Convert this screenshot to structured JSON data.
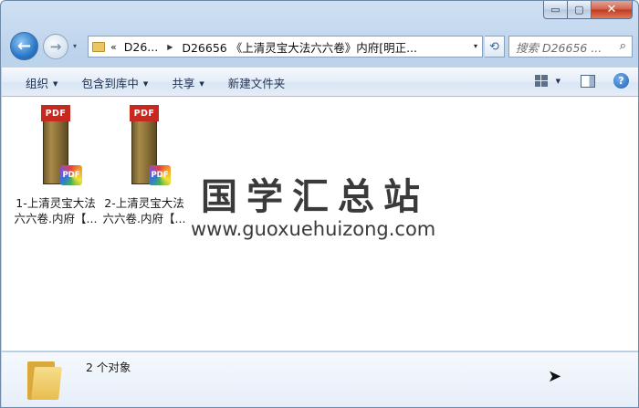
{
  "window": {
    "caption": {
      "minimize": "▭",
      "maximize": "▢",
      "close": "✕"
    }
  },
  "nav": {
    "back": "←",
    "forward": "→",
    "history_drop": "▾",
    "breadcrumb_more": "«",
    "breadcrumbs": [
      "D26...",
      "D26656 《上清灵宝大法六六卷》内府[明正..."
    ],
    "address_drop": "▾",
    "refresh": "⟲",
    "search_placeholder": "搜索 D26656 ...",
    "search_icon": "search-icon"
  },
  "toolbar": {
    "organize": "组织",
    "include_library": "包含到库中",
    "share": "共享",
    "new_folder": "新建文件夹",
    "help": "?"
  },
  "files": [
    {
      "thumb_label": "PDF",
      "badge": "PDF",
      "line1": "1-上清灵宝大法",
      "line2": "六六卷.内府【..."
    },
    {
      "thumb_label": "PDF",
      "badge": "PDF",
      "line1": "2-上清灵宝大法",
      "line2": "六六卷.内府【..."
    }
  ],
  "watermark": {
    "title": "国学汇总站",
    "url": "www.guoxuehuizong.com"
  },
  "details": {
    "count": "2 个对象"
  }
}
